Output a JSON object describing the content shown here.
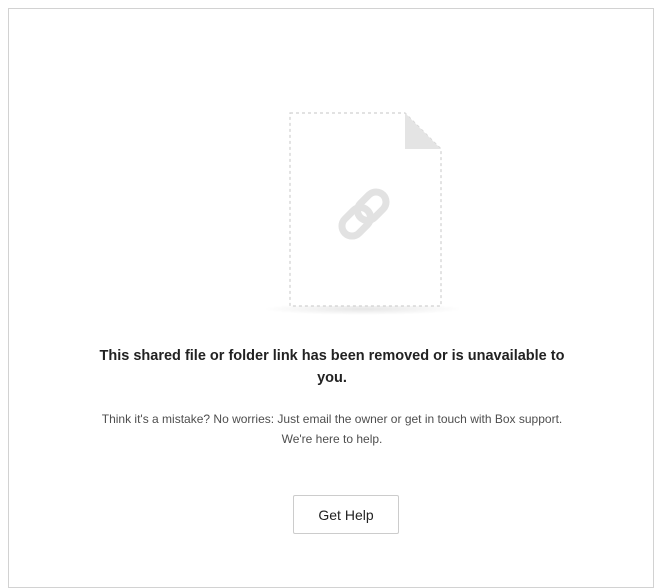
{
  "error": {
    "headline": "This shared file or folder link has been removed or is unavailable to you.",
    "subtext": "Think it's a mistake? No worries: Just email the owner or get in touch with Box support. We're here to help."
  },
  "actions": {
    "help_label": "Get Help"
  },
  "illustration": {
    "icon": "broken-link-file-icon",
    "colors": {
      "page_border": "#d0d0d0",
      "fold": "#e4e4e4",
      "link": "#e2e2e2"
    }
  }
}
